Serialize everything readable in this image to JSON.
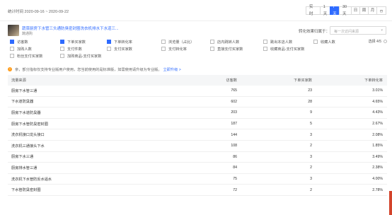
{
  "header": {
    "date_range": "统计时间 2020-09-16 ~ 2020-09-22",
    "ranges": [
      "实 时",
      "1天",
      "7天",
      "30天",
      "日",
      "周",
      "月"
    ],
    "active_range": "7天"
  },
  "product": {
    "title": "蔬菜厨房下水管三头通防臭密封圈洗衣机排水下水道三...",
    "shop": "蔬通购",
    "switch_label": "转化效果归属于：",
    "select_placeholder": "每一次访问来源"
  },
  "metrics": [
    {
      "label": "访客数",
      "checked": true
    },
    {
      "label": "下单买家数",
      "checked": true
    },
    {
      "label": "下单转化率",
      "checked": true
    },
    {
      "label": "浏览量（占比）",
      "checked": false
    },
    {
      "label": "店内跳转人数",
      "checked": false
    },
    {
      "label": "跳出本店人数",
      "checked": false
    },
    {
      "label": "收藏人数",
      "checked": false
    },
    {
      "label": "加购人数",
      "checked": false
    },
    {
      "label": "支付件数",
      "checked": false
    },
    {
      "label": "支付买家数",
      "checked": false
    },
    {
      "label": "支付转化率",
      "checked": false
    },
    {
      "label": "直接支付买家数",
      "checked": false
    },
    {
      "label": "收藏商品-支付买家数",
      "checked": false
    },
    {
      "label": "粉丝支付买家数",
      "checked": false
    },
    {
      "label": "加购商品-支付买家数",
      "checked": false
    }
  ],
  "choose_label": "选择 4/5",
  "notice": {
    "text": "亲，部分指标仅支持专业版用户使用，您当前使用的是标准版，如需使用请升级为专业版。",
    "link": "立即升级 >"
  },
  "table": {
    "headers": [
      "流量来源",
      "访客数",
      "下单买家数",
      "下单转化率"
    ],
    "rows": [
      [
        "厨房下水管三通",
        "765",
        "23",
        "3.01%"
      ],
      [
        "下水道防臭器",
        "602",
        "28",
        "4.65%"
      ],
      [
        "厨房下水道防臭器",
        "203",
        "9",
        "4.43%"
      ],
      [
        "厨房下水管防臭密封圈",
        "187",
        "5",
        "2.67%"
      ],
      [
        "洗衣机接口龙头接口",
        "144",
        "3",
        "2.08%"
      ],
      [
        "洗衣机三通接头下水",
        "108",
        "2",
        "1.85%"
      ],
      [
        "厨房下水三通",
        "86",
        "3",
        "3.49%"
      ],
      [
        "厨房排水管三通",
        "84",
        "2",
        "2.38%"
      ],
      [
        "洗衣机下水管防反水逼水",
        "75",
        "3",
        "4.00%"
      ],
      [
        "下水管防臭密封圈",
        "72",
        "2",
        "2.78%"
      ]
    ]
  }
}
